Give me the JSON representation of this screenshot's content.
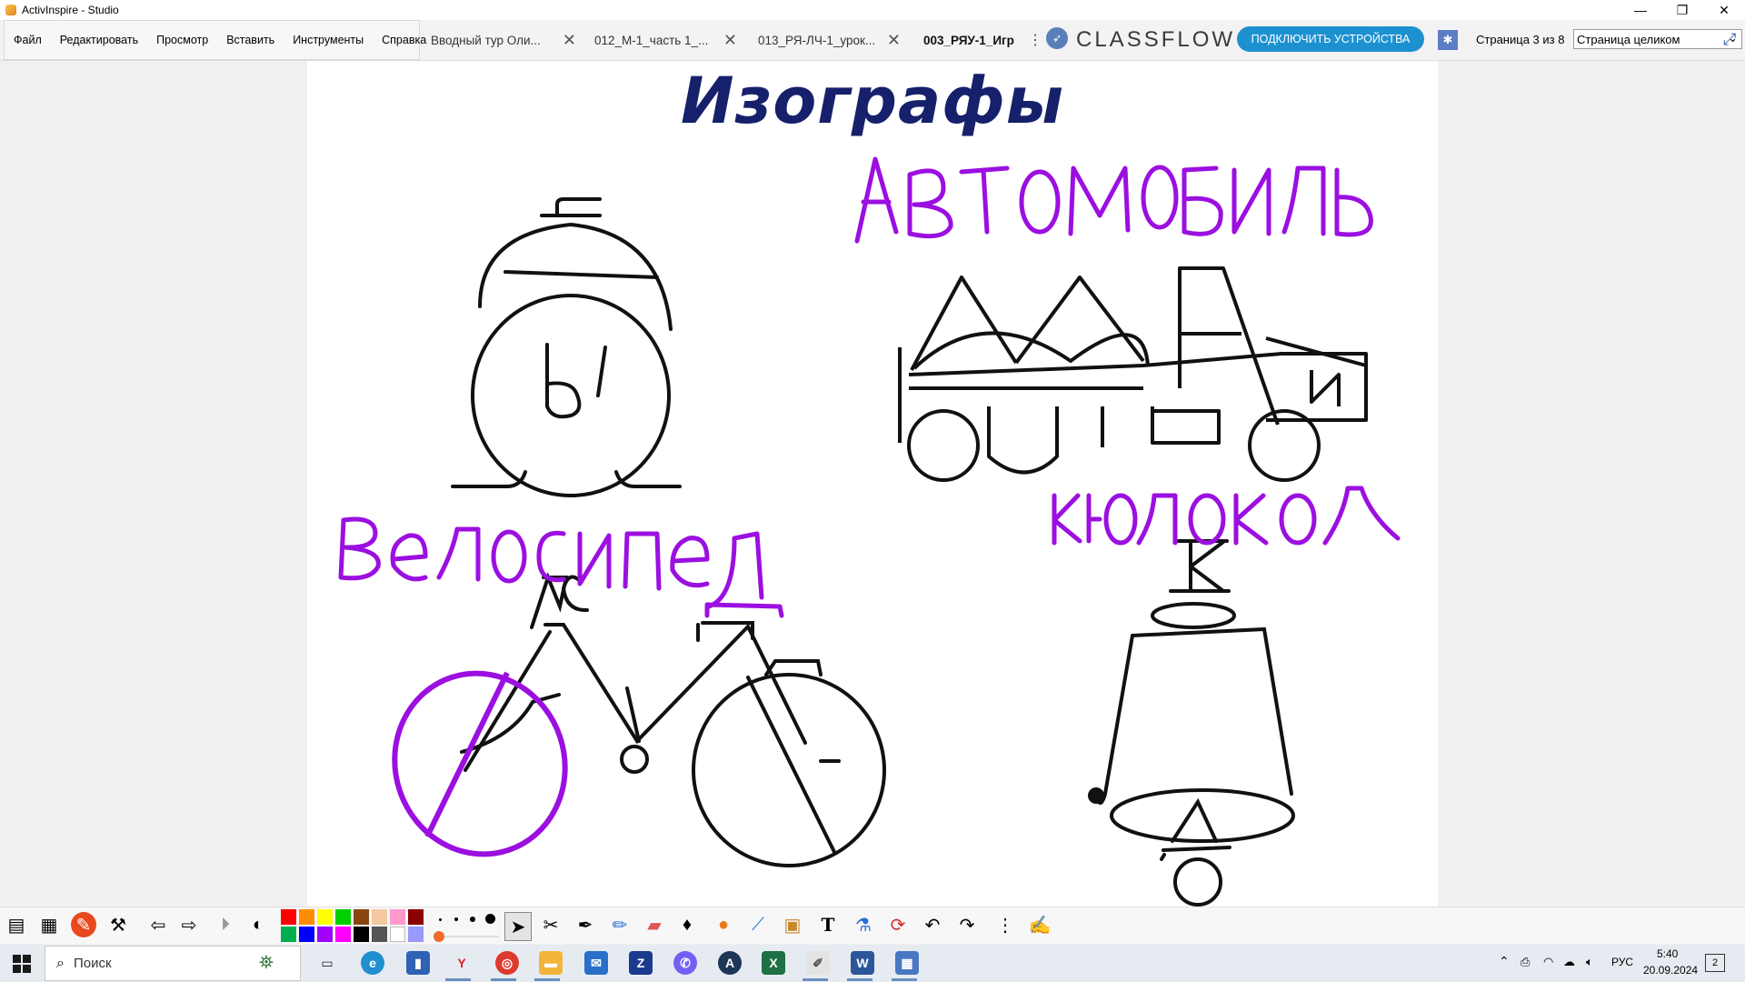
{
  "window": {
    "title": "ActivInspire - Studio"
  },
  "menu": [
    "Файл",
    "Редактировать",
    "Просмотр",
    "Вставить",
    "Инструменты",
    "Справка"
  ],
  "tabs": [
    {
      "label": "Вводный тур Оли..."
    },
    {
      "label": "012_М-1_часть 1_..."
    },
    {
      "label": "013_РЯ-ЛЧ-1_урок..."
    },
    {
      "label": "003_РЯУ-1_Игр",
      "active": true
    }
  ],
  "classflow": {
    "logo": "CLASSFLOW",
    "connect_button": "ПОДКЛЮЧИТЬ УСТРОЙСТВА"
  },
  "page": {
    "indicator": "Страница 3 из 8",
    "zoom": "Страница целиком"
  },
  "flipchart": {
    "title": "Изографы",
    "title_color": "#16206b",
    "ink_color": "#9b0fe0",
    "handwritten_words": [
      "АВТОМОБИЛЬ",
      "ВЕЛОСИПЕД",
      "КОЛОКОЛ"
    ],
    "drawing_letters": {
      "clock": "Ы",
      "bicycle": "ВС",
      "bell": [
        "К",
        "О",
        "Д",
        "О"
      ],
      "car": "И"
    }
  },
  "toolbar": {
    "colors": [
      "#ff0000",
      "#ff8c00",
      "#ffff00",
      "#00d000",
      "#8b4513",
      "#f5c9a0",
      "#ff99cc",
      "#8b0000",
      "#00b050",
      "#0000ff",
      "#a000ff",
      "#ff00ff",
      "#000000",
      "#555555",
      "#ffffff",
      "#9999ff"
    ]
  },
  "taskbar": {
    "search_placeholder": "Поиск",
    "language": "РУС",
    "time": "5:40",
    "date": "20.09.2024",
    "notifications": "2"
  }
}
